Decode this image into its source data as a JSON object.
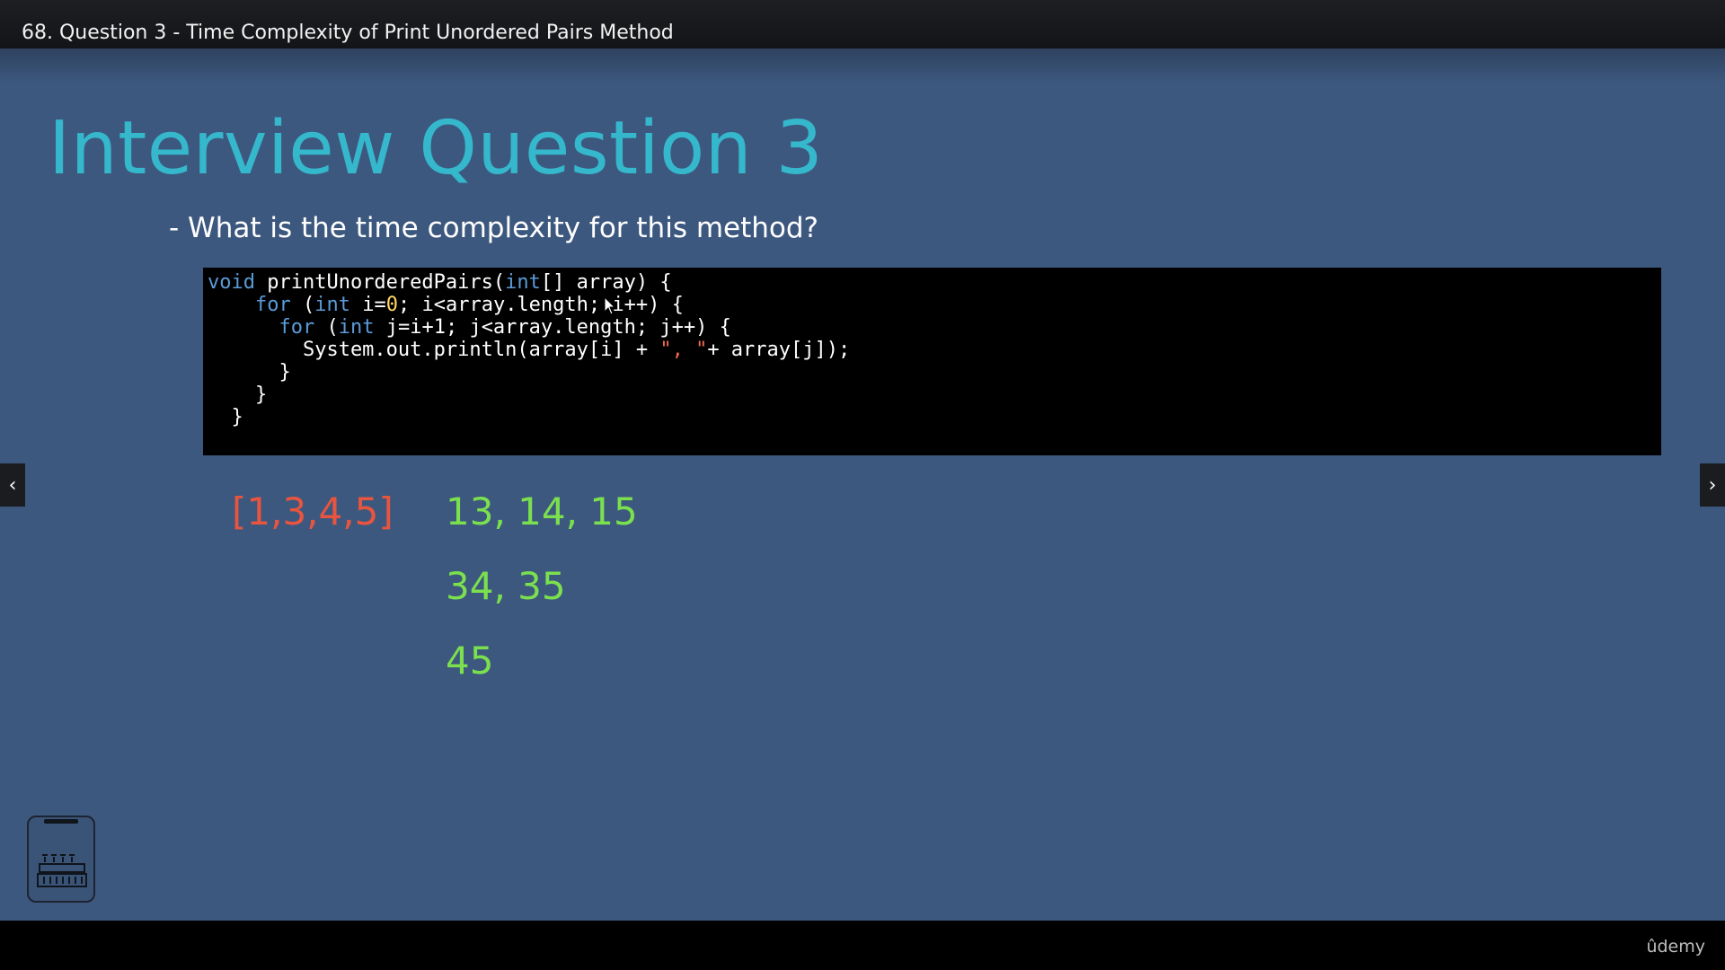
{
  "header": {
    "lecture_title": "68. Question 3 - Time Complexity of Print Unordered Pairs Method"
  },
  "slide": {
    "title": "Interview Question 3",
    "bullet": "- What is the time complexity for this method?",
    "array_example": "[1,3,4,5]",
    "pairs": [
      "13, 14, 15",
      "34, 35",
      "45"
    ]
  },
  "code": {
    "keyword_color": "#5a9bd8",
    "number_color": "#ffd866",
    "string_color": "#f26a4f"
  },
  "colors": {
    "background": "#3d587f",
    "title": "#35b7cc",
    "array_text": "#e8553f",
    "pairs_text": "#7be04e"
  },
  "nav": {
    "prev_icon": "chevron-left-icon",
    "next_icon": "chevron-right-icon",
    "prev_glyph": "‹",
    "next_glyph": "›"
  },
  "footer": {
    "brand": "ûdemy"
  },
  "icons": {
    "device": "building-icon",
    "pointer": "mouse-pointer-icon"
  }
}
